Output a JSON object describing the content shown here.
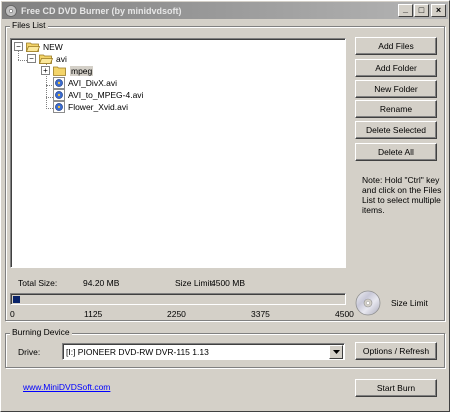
{
  "window": {
    "title": "Free CD DVD Burner (by minidvdsoft)",
    "minimize_glyph": "_",
    "maximize_glyph": "□",
    "close_glyph": "×"
  },
  "files_list": {
    "group_label": "Files List",
    "tree": [
      {
        "label": "NEW",
        "icon": "folder-open-icon",
        "expander": "−"
      },
      {
        "label": "avi",
        "icon": "folder-open-icon",
        "expander": "−"
      },
      {
        "label": "mpeg",
        "icon": "folder-icon",
        "expander": "+",
        "selected": true
      },
      {
        "label": "AVI_DivX.avi",
        "icon": "video-file-icon"
      },
      {
        "label": "AVI_to_MPEG-4.avi",
        "icon": "video-file-icon"
      },
      {
        "label": "Flower_Xvid.avi",
        "icon": "video-file-icon"
      }
    ],
    "buttons": {
      "add_files": "Add Files",
      "add_folder": "Add Folder",
      "new_folder": "New Folder",
      "rename": "Rename",
      "delete_selected": "Delete Selected",
      "delete_all": "Delete All"
    },
    "note": "Note: Hold \"Ctrl\" key and click on the Files List to select multiple items."
  },
  "size": {
    "total_label": "Total Size:",
    "total_value": "94.20 MB",
    "limit_label": "Size Limit:",
    "limit_value": "4500 MB",
    "progress_fraction": 0.021,
    "ticks": [
      "0",
      "1125",
      "2250",
      "3375",
      "4500"
    ],
    "disc_label": "Size Limit",
    "disc_icon": "disc-icon"
  },
  "burning": {
    "group_label": "Burning Device",
    "drive_label": "Drive:",
    "drive_value": "[I:] PIONEER DVD-RW  DVR-115 1.13",
    "options_button": "Options / Refresh"
  },
  "footer": {
    "link": "www.MiniDVDSoft.com",
    "start_button": "Start Burn"
  },
  "colors": {
    "face": "#d4d0c8",
    "progress_fill": "#0a246a",
    "link": "#0000ff",
    "title_gradient_start": "#808080"
  }
}
